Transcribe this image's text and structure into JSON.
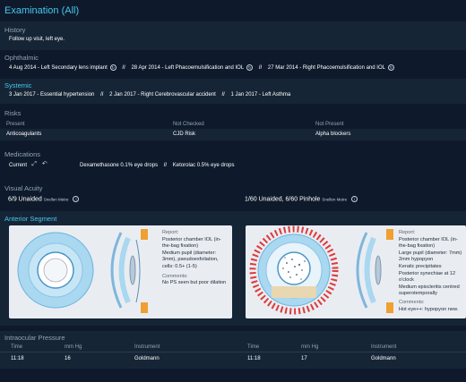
{
  "title": "Examination (All)",
  "history": {
    "header": "History",
    "text": "Follow up visit, left eye."
  },
  "ophthalmic": {
    "header": "Ophthalmic",
    "items": [
      "4 Aug 2014 - Left Secondary lens implant",
      "28 Apr 2014 - Left Phacoemulsification and IOL",
      "27 Mar 2014 - Right Phacoemulsification and IOL"
    ]
  },
  "systemic": {
    "header": "Systemic",
    "items": [
      "3 Jan 2017 - Essential hypertension",
      "2 Jan 2017 - Right Cerebrovascular accident",
      "1 Jan 2017 - Left Asthma"
    ]
  },
  "risks": {
    "header": "Risks",
    "columns": [
      "Present",
      "Not Checked",
      "Not Present"
    ],
    "values": [
      "Anticoagulants",
      "CJD Risk",
      "Alpha blockers"
    ]
  },
  "medications": {
    "header": "Medications",
    "current_label": "Current",
    "items": [
      "Dexamethasone 0.1% eye drops",
      "Ketorolac 0.5% eye drops"
    ]
  },
  "visual_acuity": {
    "header": "Visual Acuity",
    "right": "6/9 Unaided",
    "left": "1/60 Unaided, 6/60 Pinhole",
    "unit": "Snellen Metre"
  },
  "anterior": {
    "header": "Anterior Segment",
    "right": {
      "report_label": "Report:",
      "report": [
        "Posterior chamber IOL (in-",
        "the-bag fixation)",
        "Medium pupil (diameter:",
        "3mm), pseudoexfoliation,",
        "cells: 0.5+ (1-5)"
      ],
      "comments_label": "Comments:",
      "comments": "No PS seen but poor dilation"
    },
    "left": {
      "report_label": "Report:",
      "report": [
        "Posterior chamber IOL (in-",
        "the-bag fixation)",
        "Large pupil (diameter: 7mm)",
        "2mm hypopyon",
        "Keratic precipitates",
        "Posterior synechiae at 12",
        "o'clock",
        "Medium episcleritis centred",
        "superotemporally"
      ],
      "comments_label": "Comments:",
      "comments": "Hot eye++: hypopyon new."
    }
  },
  "iop": {
    "header": "Intraocular Pressure",
    "columns": [
      "Time",
      "mm Hg",
      "Instrument"
    ],
    "right": {
      "time": "11:18",
      "mmhg": "16",
      "instrument": "Goldmann"
    },
    "left": {
      "time": "11:18",
      "mmhg": "17",
      "instrument": "Goldmann"
    }
  },
  "colors": {
    "accent": "#47c6f0",
    "background": "#0e1a2b",
    "band": "#162536"
  },
  "icons": [
    "rotate-icon",
    "expand-icon",
    "undo-icon",
    "info-icon"
  ]
}
